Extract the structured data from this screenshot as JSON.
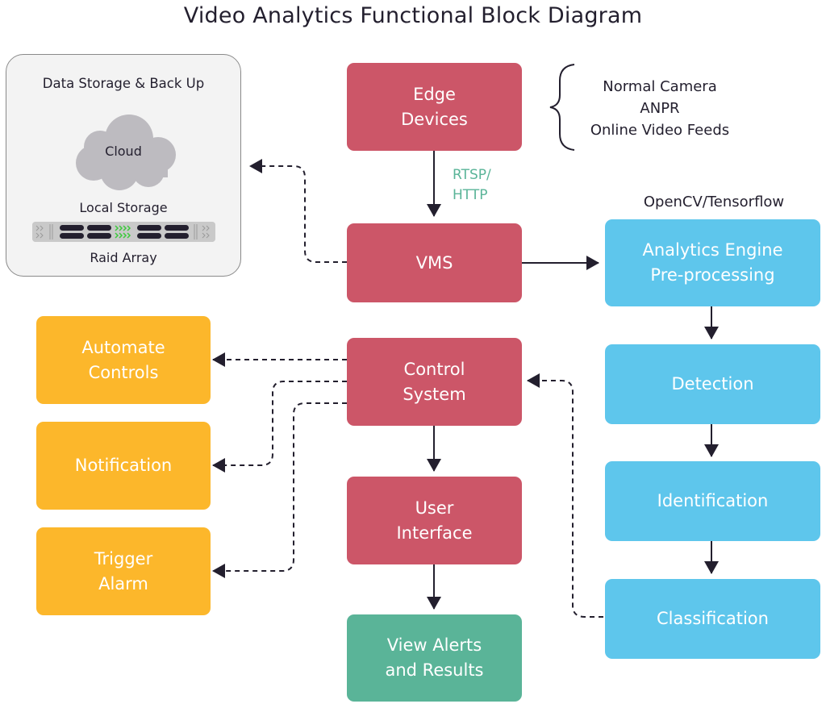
{
  "title": "Video Analytics Functional Block Diagram",
  "colors": {
    "core": "#cc5668",
    "analytics": "#5ec6ec",
    "actions": "#fcb72b",
    "output": "#5ab498",
    "protocol_text": "#5ab498",
    "arrow": "#231f2e",
    "storage_bg": "#f3f3f3"
  },
  "storage": {
    "title": "Data Storage & Back Up",
    "cloud_label": "Cloud",
    "local_label": "Local Storage",
    "raid_label": "Raid Array",
    "cloud_icon": "cloud-icon",
    "raid_icon": "server-rack-icon"
  },
  "blocks": {
    "edge_devices": [
      "Edge",
      "Devices"
    ],
    "vms": [
      "VMS"
    ],
    "control_system": [
      "Control",
      "System"
    ],
    "user_interface": [
      "User",
      "Interface"
    ],
    "view_alerts": [
      "View Alerts",
      "and Results"
    ],
    "analytics_engine": [
      "Analytics Engine",
      "Pre-processing"
    ],
    "detection": [
      "Detection"
    ],
    "identification": [
      "Identification"
    ],
    "classification": [
      "Classification"
    ],
    "automate_controls": [
      "Automate",
      "Controls"
    ],
    "notification": [
      "Notification"
    ],
    "trigger_alarm": [
      "Trigger",
      "Alarm"
    ]
  },
  "edge_sources": [
    "Normal Camera",
    "ANPR",
    "Online Video Feeds"
  ],
  "protocol": [
    "RTSP/",
    "HTTP"
  ],
  "engine_library": "OpenCV/Tensorflow",
  "connections": [
    {
      "from": "Edge Devices",
      "to": "VMS",
      "style": "solid",
      "label": "RTSP/HTTP"
    },
    {
      "from": "VMS",
      "to": "Data Storage & Back Up",
      "style": "dashed"
    },
    {
      "from": "VMS",
      "to": "Analytics Engine Pre-processing",
      "style": "solid"
    },
    {
      "from": "Analytics Engine Pre-processing",
      "to": "Detection",
      "style": "solid"
    },
    {
      "from": "Detection",
      "to": "Identification",
      "style": "solid"
    },
    {
      "from": "Identification",
      "to": "Classification",
      "style": "solid"
    },
    {
      "from": "Classification",
      "to": "Control System",
      "style": "dashed"
    },
    {
      "from": "Control System",
      "to": "Automate Controls",
      "style": "dashed"
    },
    {
      "from": "Control System",
      "to": "Notification",
      "style": "dashed"
    },
    {
      "from": "Control System",
      "to": "Trigger Alarm",
      "style": "dashed"
    },
    {
      "from": "Control System",
      "to": "User Interface",
      "style": "solid"
    },
    {
      "from": "User Interface",
      "to": "View Alerts and Results",
      "style": "solid"
    }
  ]
}
